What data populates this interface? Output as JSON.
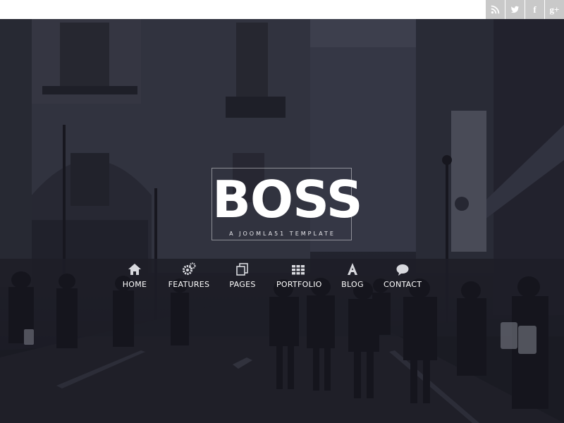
{
  "social": [
    {
      "name": "rss-icon"
    },
    {
      "name": "twitter-icon"
    },
    {
      "name": "facebook-icon",
      "glyph": "f"
    },
    {
      "name": "google-plus-icon",
      "glyph": "g+"
    }
  ],
  "logo": {
    "title": "BOSS",
    "subtitle": "A JOOMLA51 TEMPLATE"
  },
  "menu": {
    "items": [
      {
        "label": "HOME",
        "icon": "home-icon",
        "active": true
      },
      {
        "label": "FEATURES",
        "icon": "gears-icon",
        "active": false
      },
      {
        "label": "PAGES",
        "icon": "pages-icon",
        "active": false
      },
      {
        "label": "PORTFOLIO",
        "icon": "grid-icon",
        "active": false
      },
      {
        "label": "BLOG",
        "icon": "font-icon",
        "active": false
      },
      {
        "label": "CONTACT",
        "icon": "chat-bubble-icon",
        "active": false
      }
    ]
  },
  "colors": {
    "social_bg": "#c9c9c9",
    "overlay": "#1c1e2a",
    "text": "#ffffff"
  }
}
